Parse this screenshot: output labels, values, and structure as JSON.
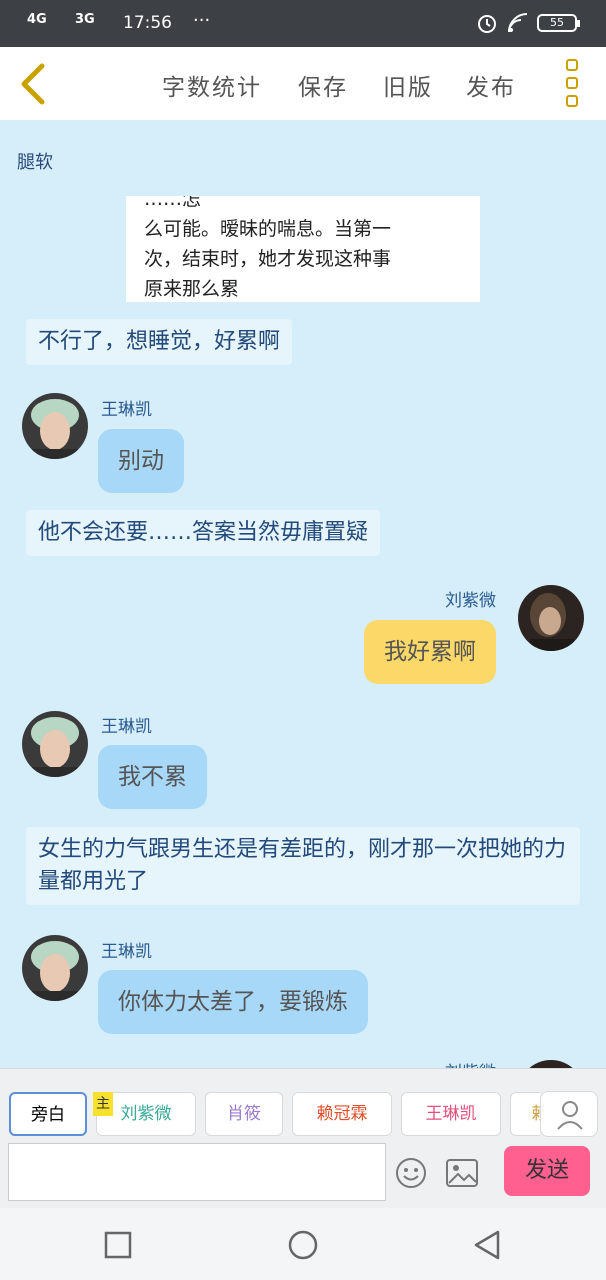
{
  "status_bar": {
    "signal1": "4G",
    "signal2": "3G",
    "time": "17:56",
    "more": "···",
    "battery": "55"
  },
  "toolbar": {
    "word_count": "字数统计",
    "save": "保存",
    "old_version": "旧版",
    "publish": "发布"
  },
  "chat": {
    "title": "腿软",
    "image_text": [
      "……怎",
      "么可能。暧昧的喘息。当第一",
      "次，结束时，她才发现这种事",
      "原来那么累"
    ],
    "messages": [
      {
        "type": "narration",
        "text": "不行了，想睡觉，好累啊"
      },
      {
        "type": "left",
        "name": "王琳凯",
        "text": "别动"
      },
      {
        "type": "narration",
        "text": "他不会还要……答案当然毋庸置疑"
      },
      {
        "type": "right",
        "name": "刘紫微",
        "text": "我好累啊"
      },
      {
        "type": "left",
        "name": "王琳凯",
        "text": "我不累"
      },
      {
        "type": "narration",
        "text": "女生的力气跟男生还是有差距的，刚才那一次把她的力量都用光了"
      },
      {
        "type": "left",
        "name": "王琳凯",
        "text": "你体力太差了，要锻炼"
      },
      {
        "type": "right",
        "name": "刘紫微",
        "text": ""
      }
    ]
  },
  "roles": {
    "host_badge": "主",
    "items": [
      {
        "label": "旁白",
        "color": "#333333"
      },
      {
        "label": "刘紫微",
        "color": "#3aaa9a"
      },
      {
        "label": "肖筱",
        "color": "#9b7ad0"
      },
      {
        "label": "赖冠霖",
        "color": "#e0502a"
      },
      {
        "label": "王琳凯",
        "color": "#e0507a"
      },
      {
        "label": "赖",
        "color": "#d0a040"
      }
    ]
  },
  "input": {
    "placeholder": "",
    "send_label": "发送"
  },
  "colors": {
    "accent_yellow": "#fcd868",
    "bubble_blue": "#a8d8f8",
    "send_pink": "#ff6090",
    "chat_bg": "#d6eefa"
  }
}
